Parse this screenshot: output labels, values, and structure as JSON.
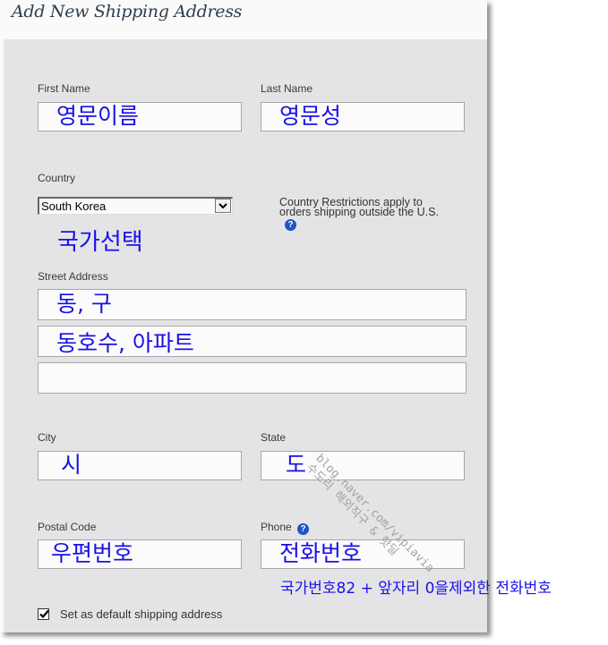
{
  "header": {
    "title": "Add New Shipping Address"
  },
  "form": {
    "first_name": {
      "label": "First Name",
      "value": "영문이름"
    },
    "last_name": {
      "label": "Last Name",
      "value": "영문성"
    },
    "country": {
      "label": "Country",
      "selected": "South Korea",
      "restriction_note_line1": "Country Restrictions apply to",
      "restriction_note_line2": "orders shipping outside the U.S.",
      "help_icon": "?"
    },
    "street_address": {
      "label": "Street Address",
      "line1": "동, 구",
      "line2": "동호수, 아파트",
      "line3": ""
    },
    "city": {
      "label": "City",
      "value": "시"
    },
    "state": {
      "label": "State",
      "value": "도"
    },
    "postal_code": {
      "label": "Postal Code",
      "value": "우편번호"
    },
    "phone": {
      "label": "Phone",
      "value": "전화번호",
      "help_icon": "?"
    },
    "default_checkbox": {
      "label": "Set as default shipping address",
      "checked": true
    }
  },
  "annotations": {
    "country_hint": "국가선택",
    "phone_hint": "국가번호82 + 앞자리 0을제외한 전화번호"
  },
  "watermark": {
    "line1": "blog.naver.com/vipiavia",
    "line2": "수도리 해외직구 & 핫딜"
  },
  "colors": {
    "annotation_blue": "#1a10e8",
    "panel_bg": "#e4e4e6",
    "help_icon_blue": "#1d56c4"
  }
}
